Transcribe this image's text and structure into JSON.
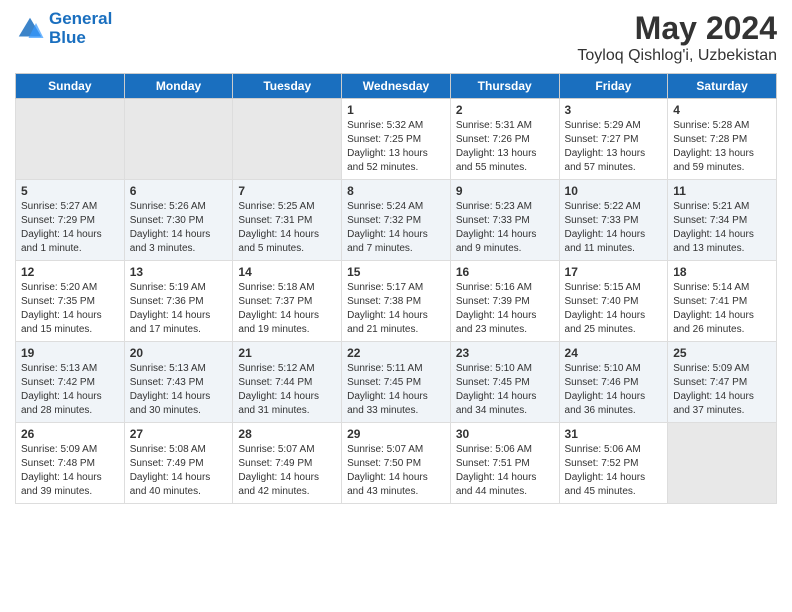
{
  "logo": {
    "line1": "General",
    "line2": "Blue"
  },
  "title": "May 2024",
  "location": "Toyloq Qishlog'i, Uzbekistan",
  "weekdays": [
    "Sunday",
    "Monday",
    "Tuesday",
    "Wednesday",
    "Thursday",
    "Friday",
    "Saturday"
  ],
  "weeks": [
    [
      {
        "day": "",
        "sunrise": "",
        "sunset": "",
        "daylight": "",
        "empty": true
      },
      {
        "day": "",
        "sunrise": "",
        "sunset": "",
        "daylight": "",
        "empty": true
      },
      {
        "day": "",
        "sunrise": "",
        "sunset": "",
        "daylight": "",
        "empty": true
      },
      {
        "day": "1",
        "sunrise": "Sunrise: 5:32 AM",
        "sunset": "Sunset: 7:25 PM",
        "daylight": "Daylight: 13 hours and 52 minutes."
      },
      {
        "day": "2",
        "sunrise": "Sunrise: 5:31 AM",
        "sunset": "Sunset: 7:26 PM",
        "daylight": "Daylight: 13 hours and 55 minutes."
      },
      {
        "day": "3",
        "sunrise": "Sunrise: 5:29 AM",
        "sunset": "Sunset: 7:27 PM",
        "daylight": "Daylight: 13 hours and 57 minutes."
      },
      {
        "day": "4",
        "sunrise": "Sunrise: 5:28 AM",
        "sunset": "Sunset: 7:28 PM",
        "daylight": "Daylight: 13 hours and 59 minutes."
      }
    ],
    [
      {
        "day": "5",
        "sunrise": "Sunrise: 5:27 AM",
        "sunset": "Sunset: 7:29 PM",
        "daylight": "Daylight: 14 hours and 1 minute."
      },
      {
        "day": "6",
        "sunrise": "Sunrise: 5:26 AM",
        "sunset": "Sunset: 7:30 PM",
        "daylight": "Daylight: 14 hours and 3 minutes."
      },
      {
        "day": "7",
        "sunrise": "Sunrise: 5:25 AM",
        "sunset": "Sunset: 7:31 PM",
        "daylight": "Daylight: 14 hours and 5 minutes."
      },
      {
        "day": "8",
        "sunrise": "Sunrise: 5:24 AM",
        "sunset": "Sunset: 7:32 PM",
        "daylight": "Daylight: 14 hours and 7 minutes."
      },
      {
        "day": "9",
        "sunrise": "Sunrise: 5:23 AM",
        "sunset": "Sunset: 7:33 PM",
        "daylight": "Daylight: 14 hours and 9 minutes."
      },
      {
        "day": "10",
        "sunrise": "Sunrise: 5:22 AM",
        "sunset": "Sunset: 7:33 PM",
        "daylight": "Daylight: 14 hours and 11 minutes."
      },
      {
        "day": "11",
        "sunrise": "Sunrise: 5:21 AM",
        "sunset": "Sunset: 7:34 PM",
        "daylight": "Daylight: 14 hours and 13 minutes."
      }
    ],
    [
      {
        "day": "12",
        "sunrise": "Sunrise: 5:20 AM",
        "sunset": "Sunset: 7:35 PM",
        "daylight": "Daylight: 14 hours and 15 minutes."
      },
      {
        "day": "13",
        "sunrise": "Sunrise: 5:19 AM",
        "sunset": "Sunset: 7:36 PM",
        "daylight": "Daylight: 14 hours and 17 minutes."
      },
      {
        "day": "14",
        "sunrise": "Sunrise: 5:18 AM",
        "sunset": "Sunset: 7:37 PM",
        "daylight": "Daylight: 14 hours and 19 minutes."
      },
      {
        "day": "15",
        "sunrise": "Sunrise: 5:17 AM",
        "sunset": "Sunset: 7:38 PM",
        "daylight": "Daylight: 14 hours and 21 minutes."
      },
      {
        "day": "16",
        "sunrise": "Sunrise: 5:16 AM",
        "sunset": "Sunset: 7:39 PM",
        "daylight": "Daylight: 14 hours and 23 minutes."
      },
      {
        "day": "17",
        "sunrise": "Sunrise: 5:15 AM",
        "sunset": "Sunset: 7:40 PM",
        "daylight": "Daylight: 14 hours and 25 minutes."
      },
      {
        "day": "18",
        "sunrise": "Sunrise: 5:14 AM",
        "sunset": "Sunset: 7:41 PM",
        "daylight": "Daylight: 14 hours and 26 minutes."
      }
    ],
    [
      {
        "day": "19",
        "sunrise": "Sunrise: 5:13 AM",
        "sunset": "Sunset: 7:42 PM",
        "daylight": "Daylight: 14 hours and 28 minutes."
      },
      {
        "day": "20",
        "sunrise": "Sunrise: 5:13 AM",
        "sunset": "Sunset: 7:43 PM",
        "daylight": "Daylight: 14 hours and 30 minutes."
      },
      {
        "day": "21",
        "sunrise": "Sunrise: 5:12 AM",
        "sunset": "Sunset: 7:44 PM",
        "daylight": "Daylight: 14 hours and 31 minutes."
      },
      {
        "day": "22",
        "sunrise": "Sunrise: 5:11 AM",
        "sunset": "Sunset: 7:45 PM",
        "daylight": "Daylight: 14 hours and 33 minutes."
      },
      {
        "day": "23",
        "sunrise": "Sunrise: 5:10 AM",
        "sunset": "Sunset: 7:45 PM",
        "daylight": "Daylight: 14 hours and 34 minutes."
      },
      {
        "day": "24",
        "sunrise": "Sunrise: 5:10 AM",
        "sunset": "Sunset: 7:46 PM",
        "daylight": "Daylight: 14 hours and 36 minutes."
      },
      {
        "day": "25",
        "sunrise": "Sunrise: 5:09 AM",
        "sunset": "Sunset: 7:47 PM",
        "daylight": "Daylight: 14 hours and 37 minutes."
      }
    ],
    [
      {
        "day": "26",
        "sunrise": "Sunrise: 5:09 AM",
        "sunset": "Sunset: 7:48 PM",
        "daylight": "Daylight: 14 hours and 39 minutes."
      },
      {
        "day": "27",
        "sunrise": "Sunrise: 5:08 AM",
        "sunset": "Sunset: 7:49 PM",
        "daylight": "Daylight: 14 hours and 40 minutes."
      },
      {
        "day": "28",
        "sunrise": "Sunrise: 5:07 AM",
        "sunset": "Sunset: 7:49 PM",
        "daylight": "Daylight: 14 hours and 42 minutes."
      },
      {
        "day": "29",
        "sunrise": "Sunrise: 5:07 AM",
        "sunset": "Sunset: 7:50 PM",
        "daylight": "Daylight: 14 hours and 43 minutes."
      },
      {
        "day": "30",
        "sunrise": "Sunrise: 5:06 AM",
        "sunset": "Sunset: 7:51 PM",
        "daylight": "Daylight: 14 hours and 44 minutes."
      },
      {
        "day": "31",
        "sunrise": "Sunrise: 5:06 AM",
        "sunset": "Sunset: 7:52 PM",
        "daylight": "Daylight: 14 hours and 45 minutes."
      },
      {
        "day": "",
        "sunrise": "",
        "sunset": "",
        "daylight": "",
        "empty": true
      }
    ]
  ]
}
